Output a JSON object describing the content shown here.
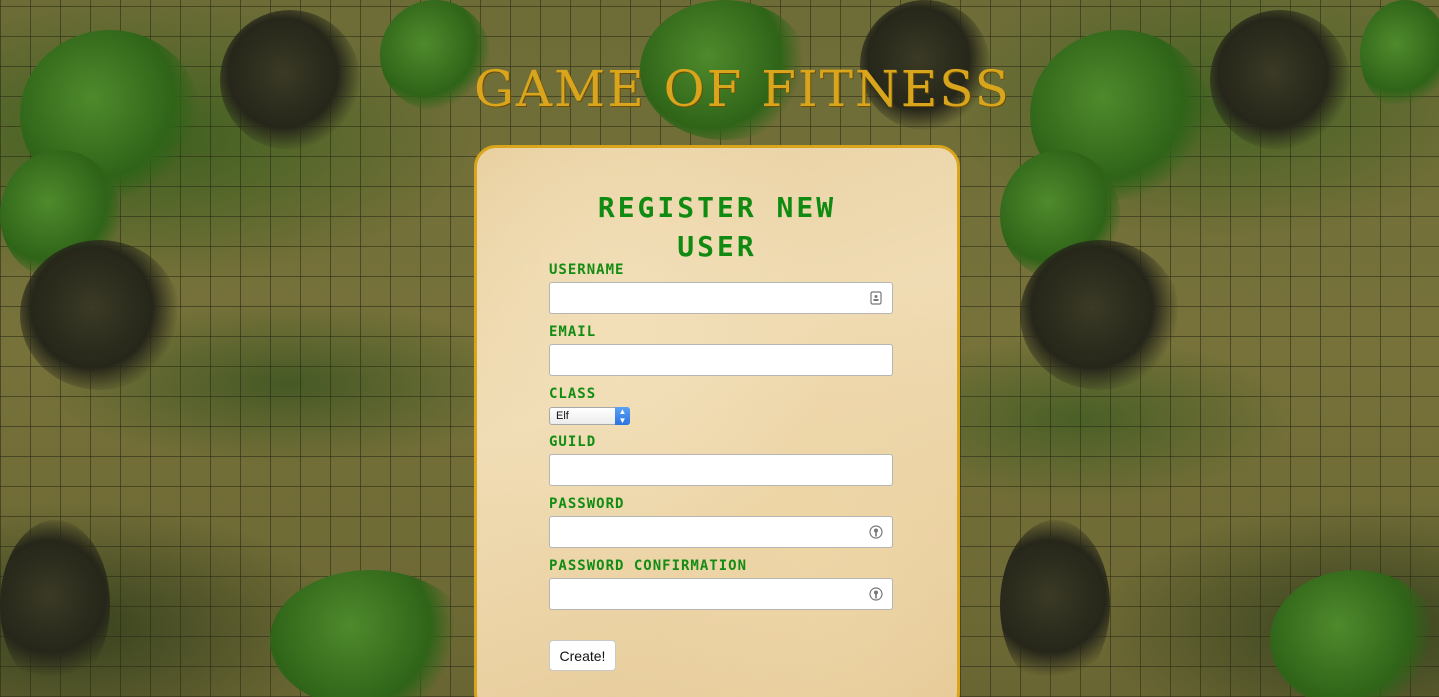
{
  "app": {
    "logo_text": "GAME OF FITNESS"
  },
  "form": {
    "title": "REGISTER NEW USER",
    "username": {
      "label": "USERNAME",
      "value": "",
      "placeholder": ""
    },
    "email": {
      "label": "EMAIL",
      "value": "",
      "placeholder": ""
    },
    "class": {
      "label": "CLASS",
      "selected": "Elf"
    },
    "guild": {
      "label": "GUILD",
      "value": "",
      "placeholder": ""
    },
    "password": {
      "label": "PASSWORD",
      "value": "",
      "placeholder": ""
    },
    "password_confirmation": {
      "label": "PASSWORD CONFIRMATION",
      "value": "",
      "placeholder": ""
    },
    "submit_label": "Create!"
  },
  "colors": {
    "logo": "#d9a51c",
    "label": "#128c12",
    "card_border": "#d9a51c"
  },
  "icons": {
    "username_field": "contact-card-icon",
    "password_field": "key-icon",
    "password_confirmation_field": "key-icon",
    "class_select": "chevron-updown-icon"
  }
}
